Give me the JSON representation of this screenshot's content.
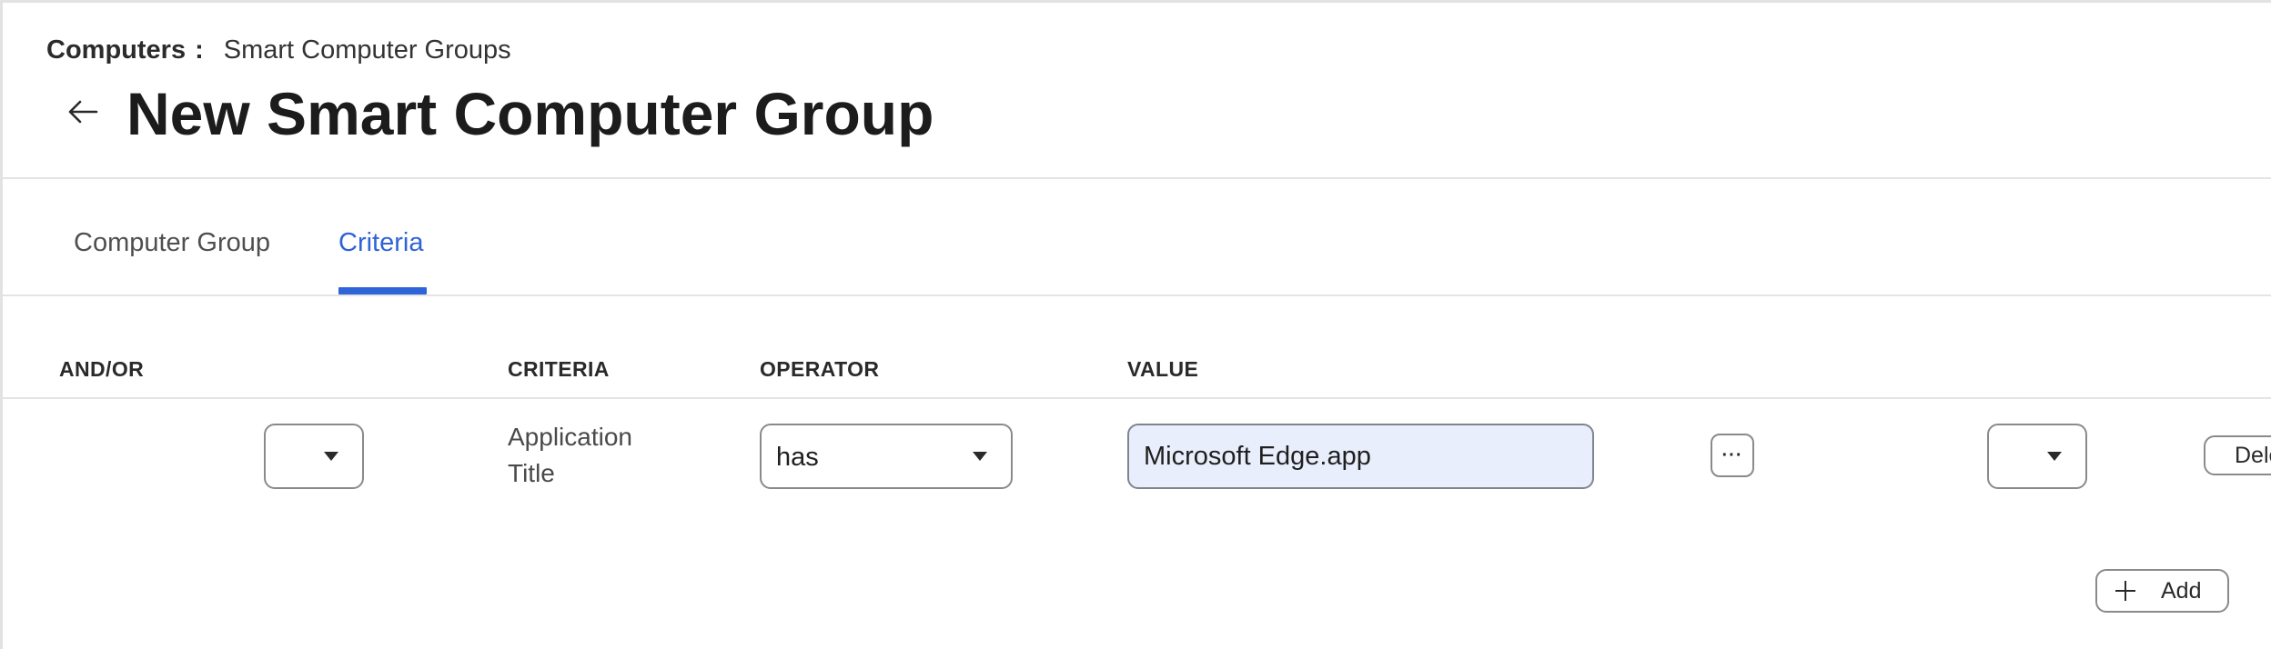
{
  "breadcrumb": {
    "parent": "Computers",
    "separator": ":",
    "current": "Smart Computer Groups"
  },
  "header": {
    "back_icon": "arrow-left-icon",
    "title": "New Smart Computer Group"
  },
  "tabs": [
    {
      "label": "Computer Group",
      "active": false
    },
    {
      "label": "Criteria",
      "active": true
    }
  ],
  "colors": {
    "accent": "#2f63d8",
    "input_fill": "#e8eefb",
    "border": "#8a8a8a"
  },
  "criteria_table": {
    "columns": {
      "and_or": "AND/OR",
      "criteria": "CRITERIA",
      "operator": "OPERATOR",
      "value": "VALUE"
    },
    "rows": [
      {
        "and_or_value": "",
        "criteria": "Application Title",
        "operator": "has",
        "value": "Microsoft Edge.app",
        "more_label": "···",
        "paren_value": "",
        "delete_label": "Delete"
      }
    ],
    "add_label": "Add"
  }
}
